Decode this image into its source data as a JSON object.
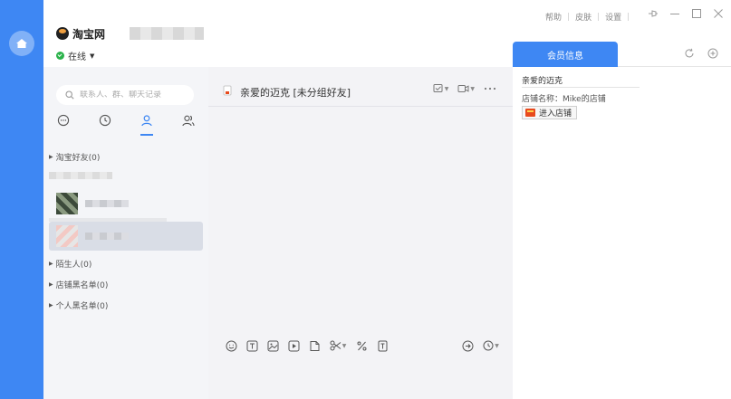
{
  "account": {
    "logo_text": "淘宝网",
    "status": "在线"
  },
  "titlebar": {
    "help": "帮助",
    "skin": "皮肤",
    "settings": "设置"
  },
  "contacts": {
    "search_placeholder": "联系人、群、聊天记录",
    "groups": [
      {
        "label": "淘宝好友(0)"
      },
      {
        "label": "陌生人(0)"
      },
      {
        "label": "店铺黑名单(0)"
      },
      {
        "label": "个人黑名单(0)"
      }
    ]
  },
  "chat": {
    "title": "亲爱的迈克 [未分组好友]"
  },
  "info_panel": {
    "tab_label": "会员信息",
    "member_name": "亲爱的迈克",
    "shop_name_line": "店铺名称：Mike的店铺",
    "enter_shop_label": "进入店铺"
  },
  "colors": {
    "accent": "#3e87f3",
    "online": "#2ab24a"
  }
}
